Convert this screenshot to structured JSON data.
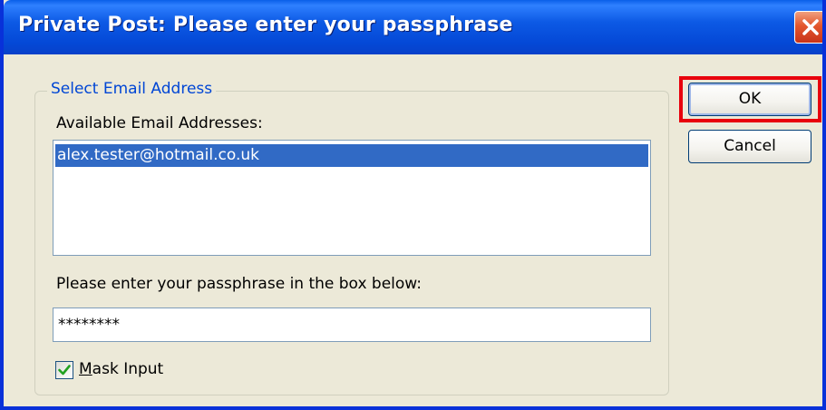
{
  "window": {
    "title": "Private Post: Please enter your passphrase"
  },
  "group": {
    "legend": "Select Email Address",
    "available_label": "Available Email Addresses:",
    "emails": [
      "alex.tester@hotmail.co.uk"
    ],
    "selected_index": 0,
    "passphrase_label": "Please enter your passphrase in the box below:",
    "passphrase_value": "********",
    "mask_input_label": "Mask Input",
    "mask_input_checked": true
  },
  "buttons": {
    "ok": "OK",
    "cancel": "Cancel"
  },
  "colors": {
    "titlebar": "#0a5fe8",
    "selection": "#316ac5",
    "highlight_border": "#e8000c",
    "group_legend": "#0046d5"
  },
  "icons": {
    "close": "close-icon",
    "check": "checkmark-icon"
  }
}
